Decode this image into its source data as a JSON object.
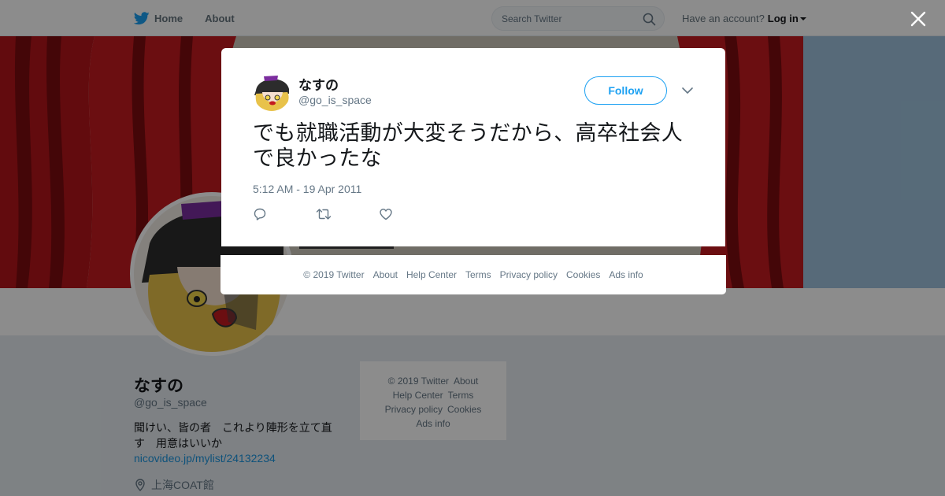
{
  "nav": {
    "home_label": "Home",
    "about_label": "About",
    "search_placeholder": "Search Twitter",
    "account_prompt": "Have an account?",
    "login_label": "Log in"
  },
  "profile": {
    "name": "なすの",
    "handle": "@go_is_space",
    "bio": "聞けい、皆の者　これより陣形を立て直す　用意はいいか",
    "url": "nicovideo.jp/mylist/24132234",
    "location": "上海COAT館"
  },
  "sidebar_footer": {
    "copyright": "© 2019 Twitter",
    "about": "About",
    "help": "Help Center",
    "terms": "Terms",
    "privacy": "Privacy policy",
    "cookies": "Cookies",
    "ads": "Ads info"
  },
  "tweet": {
    "name": "なすの",
    "handle": "@go_is_space",
    "follow_label": "Follow",
    "text": "でも就職活動が大変そうだから、高卒社会人で良かったな",
    "timestamp": "5:12 AM - 19 Apr 2011"
  },
  "modal_footer": {
    "copyright": "© 2019 Twitter",
    "about": "About",
    "help": "Help Center",
    "terms": "Terms",
    "privacy": "Privacy policy",
    "cookies": "Cookies",
    "ads": "Ads info"
  },
  "colors": {
    "twitter_blue": "#1da1f2",
    "link_blue": "#1b95e0",
    "secondary_text": "#657786",
    "curtain_red": "#b3151b"
  },
  "icons": {
    "logo": "twitter-bird-icon",
    "search": "search-icon",
    "close": "close-icon",
    "reply": "reply-icon",
    "retweet": "retweet-icon",
    "like": "heart-icon",
    "menu": "chevron-down-icon",
    "location": "location-pin-icon"
  }
}
